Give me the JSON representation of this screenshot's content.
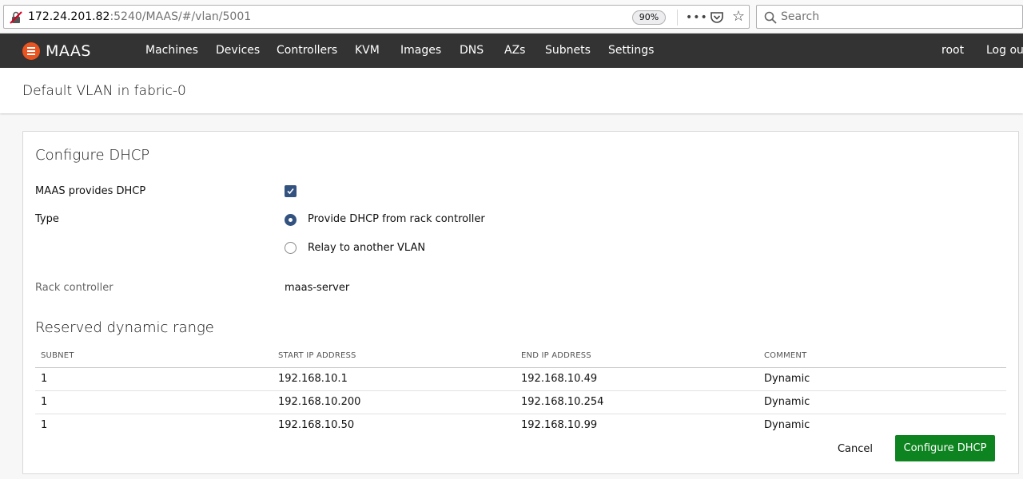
{
  "browser": {
    "url_host": "172.24.201.82",
    "url_rest": ":5240/MAAS/#/vlan/5001",
    "zoom": "90%",
    "more_glyph": "•••",
    "star_glyph": "☆",
    "search_placeholder": "Search"
  },
  "nav": {
    "logo": "MAAS",
    "items": [
      "Machines",
      "Devices",
      "Controllers",
      "KVM",
      "Images",
      "DNS",
      "AZs",
      "Subnets",
      "Settings"
    ],
    "user": "root",
    "logout": "Log out"
  },
  "page": {
    "title": "Default VLAN in fabric-0"
  },
  "dhcp": {
    "section_title": "Configure DHCP",
    "provides_label": "MAAS provides DHCP",
    "provides_checked": true,
    "type_label": "Type",
    "type_options": [
      "Provide DHCP from rack controller",
      "Relay to another VLAN"
    ],
    "type_selected": "Provide DHCP from rack controller",
    "rack_label": "Rack controller",
    "rack_value": "maas-server"
  },
  "ranges": {
    "section_title": "Reserved dynamic range",
    "headers": [
      "SUBNET",
      "START IP ADDRESS",
      "END IP ADDRESS",
      "COMMENT"
    ],
    "rows": [
      [
        "1",
        "192.168.10.1",
        "192.168.10.49",
        "Dynamic"
      ],
      [
        "1",
        "192.168.10.200",
        "192.168.10.254",
        "Dynamic"
      ],
      [
        "1",
        "192.168.10.50",
        "192.168.10.99",
        "Dynamic"
      ]
    ]
  },
  "actions": {
    "cancel": "Cancel",
    "submit": "Configure DHCP"
  },
  "colors": {
    "nav_bg": "#333333",
    "logo": "#e95420",
    "control": "#335280",
    "primary_button": "#0e8420"
  }
}
